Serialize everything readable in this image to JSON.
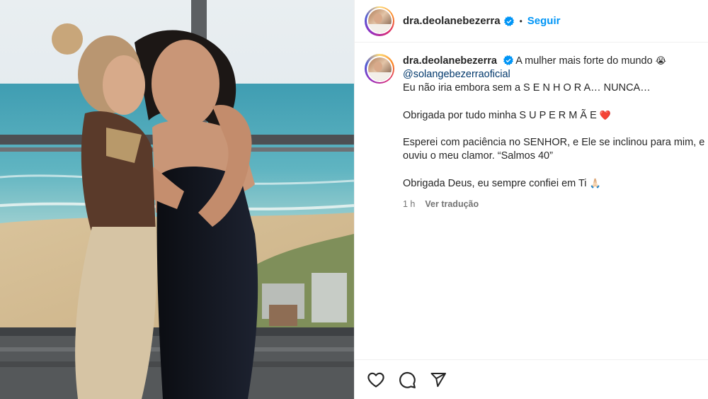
{
  "post": {
    "username": "dra.deolanebezerra",
    "follow_label": "Seguir",
    "dot": "•",
    "caption": {
      "username": "dra.deolanebezerra",
      "first_line": "A mulher mais forte do mundo",
      "first_line_emoji": "😭",
      "mention": "@solangebezerraoficial",
      "line2": "Eu não iria embora sem a S E N H O R A… NUNCA…",
      "line3": "Obrigada por tudo minha S U P E R M Ã E",
      "line3_emoji": "❤️",
      "line4a": "Esperei com paciência no SENHOR, e Ele se inclinou para mim, e",
      "line4b": "ouviu o meu clamor. “Salmos 40”",
      "line5": "Obrigada Deus, eu sempre confiei em Ti",
      "line5_emoji": "🙏🏻"
    },
    "time_ago": "1 h",
    "translate_label": "Ver tradução"
  },
  "icons": {
    "verified": "verified-badge-icon",
    "like": "heart-icon",
    "comment": "comment-icon",
    "share": "share-icon"
  },
  "colors": {
    "link_blue": "#0095f6",
    "mention": "#00376b",
    "verified": "#0095f6",
    "muted": "#737373"
  }
}
